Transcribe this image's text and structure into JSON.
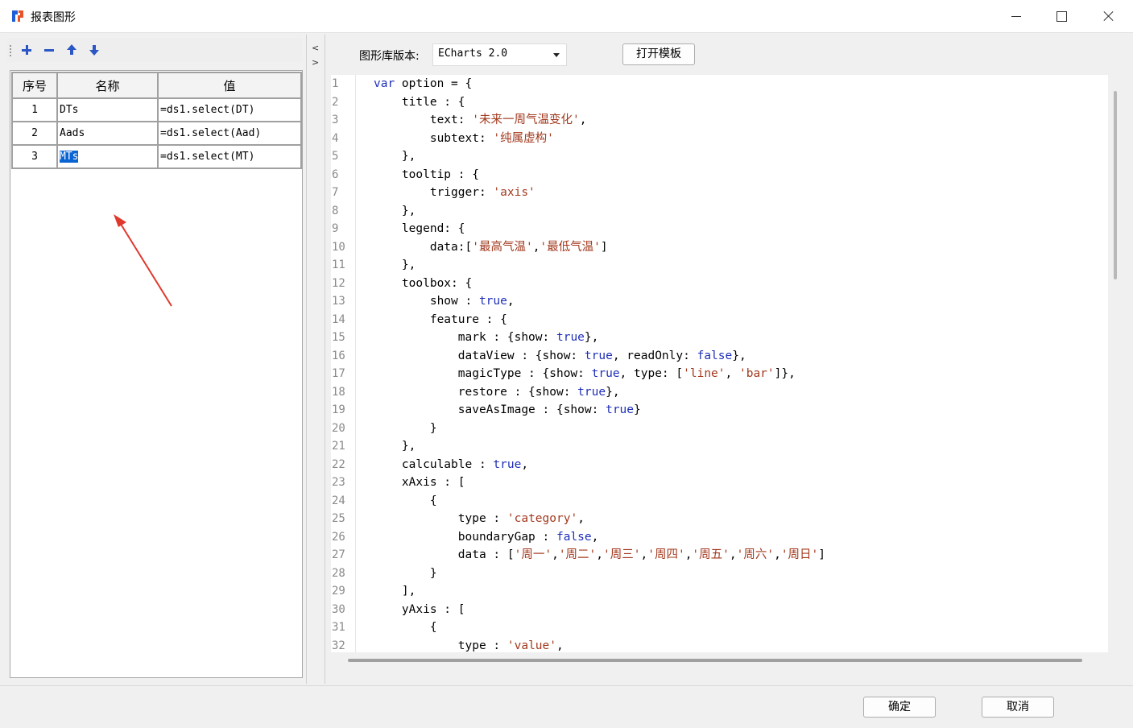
{
  "window": {
    "title": "报表图形"
  },
  "param_table": {
    "headers": [
      "序号",
      "名称",
      "值"
    ],
    "rows": [
      {
        "seq": "1",
        "name": "DTs",
        "value": "=ds1.select(DT)"
      },
      {
        "seq": "2",
        "name": "Aads",
        "value": "=ds1.select(Aad)"
      },
      {
        "seq": "3",
        "name": "MTs",
        "value": "=ds1.select(MT)"
      }
    ]
  },
  "splitter": {
    "collapse_glyph": "<",
    "expand_glyph": ">"
  },
  "chart_lib": {
    "label": "图形库版本:",
    "value": "ECharts 2.0"
  },
  "buttons": {
    "open_template": "打开模板",
    "ok": "确定",
    "cancel": "取消"
  },
  "code": {
    "lines": [
      "1",
      "2",
      "3",
      "4",
      "5",
      "6",
      "7",
      "8",
      "9",
      "10",
      "11",
      "12",
      "13",
      "14",
      "15",
      "16",
      "17",
      "18",
      "19",
      "20",
      "21",
      "22",
      "23",
      "24",
      "25",
      "26",
      "27",
      "28",
      "29",
      "30",
      "31",
      "32"
    ]
  },
  "icons": {
    "app": "app-logo-icon",
    "add": "add-icon",
    "remove": "remove-icon",
    "up": "move-up-icon",
    "down": "move-down-icon"
  },
  "colors": {
    "keyword": "#1f2fb8",
    "string": "#a2391e",
    "selection": "#0a64d2",
    "annotation_arrow": "#e0382b"
  }
}
